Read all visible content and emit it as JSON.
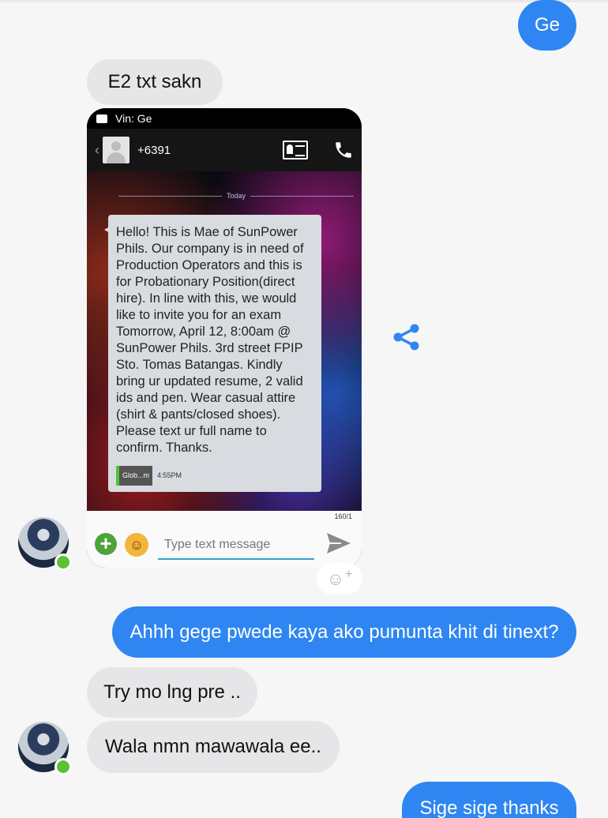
{
  "messages": {
    "out_1": "Ge",
    "in_1": "E2 txt sakn",
    "out_2": "Ahhh gege pwede kaya ako pumunta khit di tinext?",
    "in_2": "Try mo lng pre ..",
    "in_3": "Wala nmn mawawala ee..",
    "out_3": "Sige sige thanks"
  },
  "screenshot": {
    "status_text": "Vin: Ge",
    "contact_number": "+6391",
    "date_divider": "Today",
    "sms_body": "Hello! This is Mae of SunPower Phils. Our company is in need of Production Operators and this is for Probationary Position(direct hire). In line with this, we would like to invite you for an exam Tomorrow, April 12, 8:00am @ SunPower Phils. 3rd street FPIP Sto. Tomas Batangas. Kindly bring ur updated resume, 2 valid ids and pen. Wear casual attire (shirt & pants/closed shoes). Please text ur full name to confirm. Thanks.",
    "sms_network": "Glob...m",
    "sms_time": "4:55PM",
    "char_counter": "160/1",
    "input_placeholder": "Type text message"
  },
  "icons": {
    "share": "share-icon",
    "reaction": "add-reaction-icon",
    "online": "online-status-dot"
  },
  "colors": {
    "outgoing_bubble": "#2f86f2",
    "incoming_bubble": "#e6e6e8",
    "online_dot": "#5bc236"
  }
}
